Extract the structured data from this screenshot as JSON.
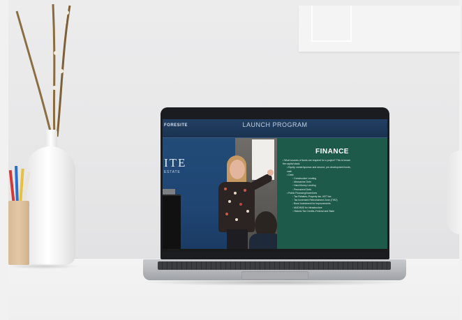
{
  "screen": {
    "topbar_left": "FORESITE",
    "topbar_title": "LAUNCH PROGRAM",
    "brand_main": "ITE",
    "brand_sub": "ESTATE"
  },
  "slide": {
    "title": "FINANCE",
    "items": [
      {
        "level": 0,
        "text": "• What sources of funds are required for a project? This is known"
      },
      {
        "level": 0,
        "text": "  the capital stack."
      },
      {
        "level": 1,
        "text": "• Equity: owner/sponsor and second, pre-development funds,"
      },
      {
        "level": 1,
        "text": "  cash"
      },
      {
        "level": 1,
        "text": "• Debt:"
      },
      {
        "level": 2,
        "text": "◦ Construction Lending"
      },
      {
        "level": 2,
        "text": "◦ Mezzanine Debt"
      },
      {
        "level": 2,
        "text": "◦ Hard Money Lending"
      },
      {
        "level": 2,
        "text": "◦ Permanent Debt"
      },
      {
        "level": 1,
        "text": "• Public Financing/Incentives"
      },
      {
        "level": 2,
        "text": "◦ Tax Rebates–Property tax, HOT tax"
      },
      {
        "level": 2,
        "text": "◦ Tax Increment Reinvestment Zone (TIRZ)"
      },
      {
        "level": 2,
        "text": "◦ Bond Investment for improvements"
      },
      {
        "level": 2,
        "text": "◦ MUD/MID for infrastructure"
      },
      {
        "level": 2,
        "text": "◦ Historic Tax Credits–Federal and State"
      }
    ]
  },
  "colors": {
    "slide_bg": "#1e5a4a",
    "brand_panel": "#224b78",
    "wall": "#e9e9ea"
  }
}
